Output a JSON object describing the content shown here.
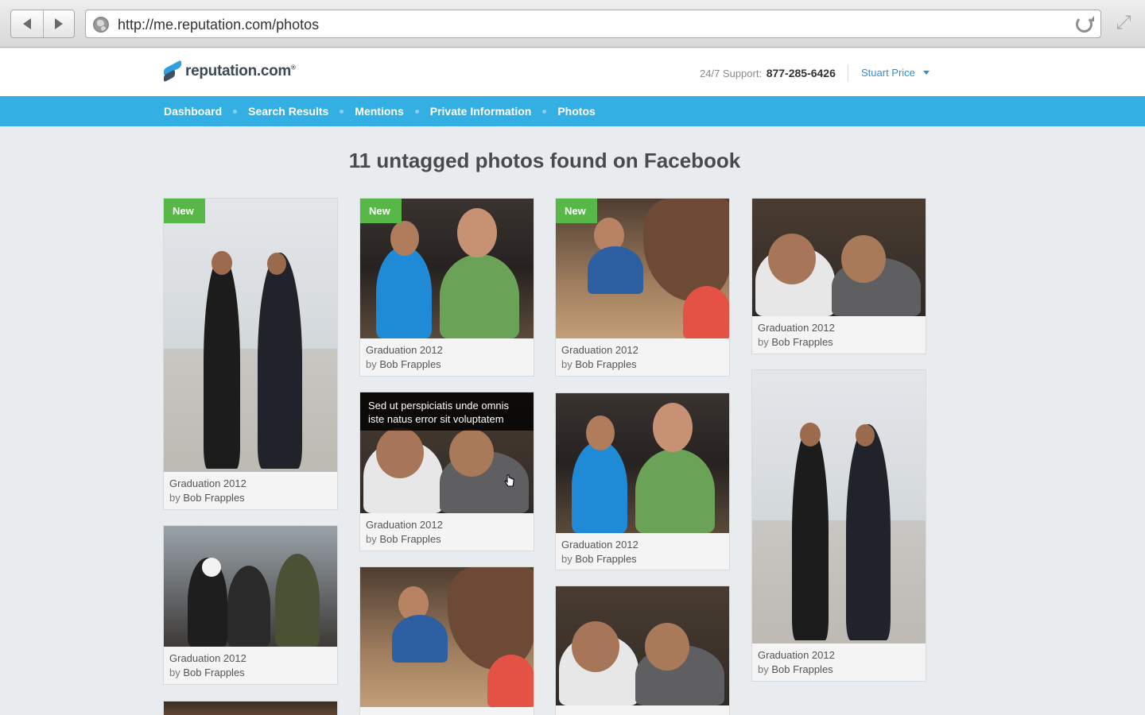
{
  "browser": {
    "url": "http://me.reputation.com/photos"
  },
  "header": {
    "logo_text": "reputation.com",
    "logo_mark": "®",
    "support_label": "24/7 Support:",
    "support_phone": "877-285-6426",
    "user_name": "Stuart Price"
  },
  "nav": {
    "items": [
      {
        "label": "Dashboard"
      },
      {
        "label": "Search Results"
      },
      {
        "label": "Mentions"
      },
      {
        "label": "Private Information"
      },
      {
        "label": "Photos"
      }
    ]
  },
  "main": {
    "title": "11 untagged photos found on Facebook",
    "badge_label": "New",
    "hover_text": "Sed ut perspiciatis unde omnis iste natus error sit voluptatem",
    "cards": [
      {
        "title": "Graduation 2012",
        "by": "by",
        "author": "Bob Frapples",
        "new": true
      },
      {
        "title": "Graduation 2012",
        "by": "by",
        "author": "Bob Frapples",
        "new": false
      },
      {
        "title": "Graduation 2012",
        "by": "by",
        "author": "Bob Frapples",
        "new": true
      },
      {
        "title": "Graduation 2012",
        "by": "by",
        "author": "Bob Frapples",
        "new": false
      },
      {
        "title": "Graduation 2012",
        "by": "by",
        "author": "Bob Frapples",
        "new": true
      },
      {
        "title": "Graduation 2012",
        "by": "by",
        "author": "Bob Frapples",
        "new": false
      },
      {
        "title": "Graduation 2012",
        "by": "by",
        "author": "Bob Frapples",
        "new": false
      },
      {
        "title": "Graduation 2012",
        "by": "by",
        "author": "Bob Frapples",
        "new": false
      },
      {
        "title": "Graduation 2012",
        "by": "by",
        "author": "Bob Frapples",
        "new": false
      }
    ]
  },
  "colors": {
    "nav_bg": "#33afe4",
    "badge": "#57b847",
    "link": "#2f8fd1",
    "page_bg": "#e9ecef"
  },
  "icons": [
    "back-arrow-icon",
    "forward-arrow-icon",
    "globe-icon",
    "reload-icon",
    "fullscreen-icon",
    "caret-down-icon",
    "hand-cursor-icon"
  ]
}
